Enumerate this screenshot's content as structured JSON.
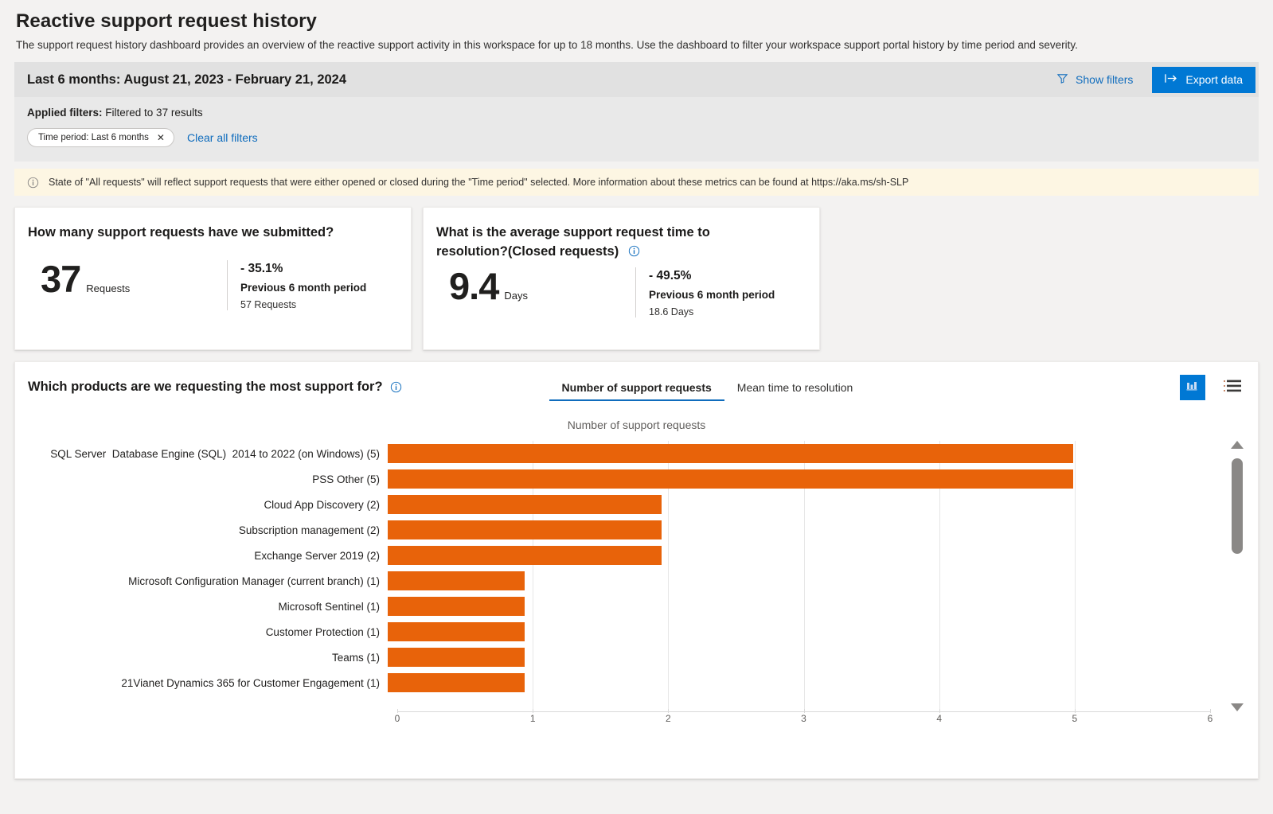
{
  "header": {
    "title": "Reactive support request history",
    "description": "The support request history dashboard provides an overview of the reactive support activity in this workspace for up to 18 months. Use the dashboard to filter your workspace support portal history by time period and severity."
  },
  "filters": {
    "range_title": "Last 6 months: August 21, 2023 - February 21, 2024",
    "show_filters_label": "Show filters",
    "export_label": "Export data",
    "applied_label": "Applied filters:",
    "applied_text": "Filtered to 37 results",
    "chips": [
      {
        "label": "Time period: Last 6 months",
        "close": "✕"
      }
    ],
    "clear_all_label": "Clear all filters"
  },
  "message_bar": {
    "text": "State of \"All requests\" will reflect support requests that were either opened or closed during the \"Time period\" selected. More information about these metrics can be found at https://aka.ms/sh-SLP"
  },
  "kpi_cards": [
    {
      "title": "How many support requests have we submitted?",
      "value": "37",
      "unit": "Requests",
      "delta": "- 35.1%",
      "previous_label": "Previous 6 month period",
      "previous_value": "57 Requests",
      "has_info": false
    },
    {
      "title_line1": "What is the average support request time to",
      "title_line2": "resolution?(Closed requests)",
      "value": "9.4",
      "unit": "Days",
      "delta": "- 49.5%",
      "previous_label": "Previous 6 month period",
      "previous_value": "18.6 Days",
      "has_info": true
    }
  ],
  "chart_card": {
    "question": "Which products are we requesting the most support for?",
    "tabs": [
      {
        "label": "Number of support requests",
        "active": true
      },
      {
        "label": "Mean time to resolution",
        "active": false
      }
    ],
    "view_buttons": [
      {
        "name": "chart-view",
        "icon": "bar-chart-icon",
        "active": true
      },
      {
        "name": "table-view",
        "icon": "list-icon",
        "active": false
      }
    ]
  },
  "chart_data": {
    "type": "bar",
    "orientation": "horizontal",
    "title": "Number of support requests",
    "xlabel": "",
    "ylabel": "",
    "xlim": [
      0,
      6
    ],
    "xticks": [
      0,
      1,
      2,
      3,
      4,
      5,
      6
    ],
    "grid": true,
    "bar_color": "#e8630a",
    "categories": [
      "SQL Server  Database Engine (SQL)  2014 to 2022 (on Windows) (5)",
      "PSS Other (5)",
      "Cloud App Discovery (2)",
      "Subscription management (2)",
      "Exchange Server 2019 (2)",
      "Microsoft Configuration Manager (current branch) (1)",
      "Microsoft Sentinel (1)",
      "Customer Protection (1)",
      "Teams (1)",
      "21Vianet Dynamics 365 for Customer Engagement (1)"
    ],
    "values": [
      5,
      5,
      2,
      2,
      2,
      1,
      1,
      1,
      1,
      1
    ]
  },
  "colors": {
    "accent": "#0078d4",
    "link": "#0f6cbd",
    "bar": "#e8630a",
    "message_bar_bg": "#fdf6e3",
    "filter_bg": "#e1e1e1"
  }
}
